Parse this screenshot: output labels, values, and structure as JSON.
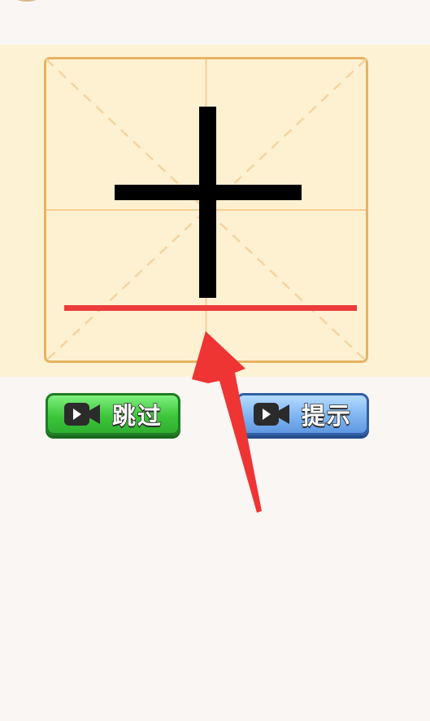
{
  "character": {
    "glyph": "十"
  },
  "buttons": {
    "skip_label": "跳过",
    "hint_label": "提示"
  },
  "icons": {
    "skip_icon": "video-camera-icon",
    "hint_icon": "video-camera-icon",
    "pointer": "red-arrow-icon"
  },
  "colors": {
    "board_background": "#fdf2d3",
    "grid_border": "#e6b363",
    "grid_guides": "#f7cf92",
    "stroke": "#000000",
    "baseline": "#ec3b3b",
    "arrow": "#ef3434",
    "skip_button": "#3ec63b",
    "hint_button": "#7fb5f2"
  }
}
